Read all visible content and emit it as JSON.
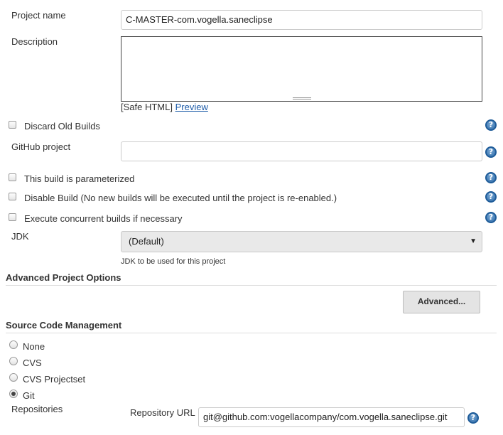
{
  "project_name": {
    "label": "Project name",
    "value": "C-MASTER-com.vogella.saneclipse"
  },
  "description": {
    "label": "Description",
    "value": ""
  },
  "safe_html": {
    "prefix": "[Safe HTML]",
    "preview_link": "Preview"
  },
  "options": {
    "discard_old_builds": "Discard Old Builds",
    "github_project_label": "GitHub project",
    "github_project_value": "",
    "parameterized": "This build is parameterized",
    "disable_build": "Disable Build (No new builds will be executed until the project is re-enabled.)",
    "concurrent": "Execute concurrent builds if necessary"
  },
  "jdk": {
    "label": "JDK",
    "selected": "(Default)",
    "hint": "JDK to be used for this project"
  },
  "advanced_options": {
    "title": "Advanced Project Options",
    "button": "Advanced..."
  },
  "scm": {
    "title": "Source Code Management",
    "options": [
      "None",
      "CVS",
      "CVS Projectset",
      "Git"
    ],
    "selected": "Git",
    "repositories_label": "Repositories",
    "repo_url_label": "Repository URL",
    "repo_url_value": "git@github.com:vogellacompany/com.vogella.saneclipse.git"
  },
  "icons": {
    "help": "help-icon",
    "dropdown": "chevron-down-icon"
  },
  "colors": {
    "link": "#1d5ba8",
    "help": "#2d6aa6"
  }
}
